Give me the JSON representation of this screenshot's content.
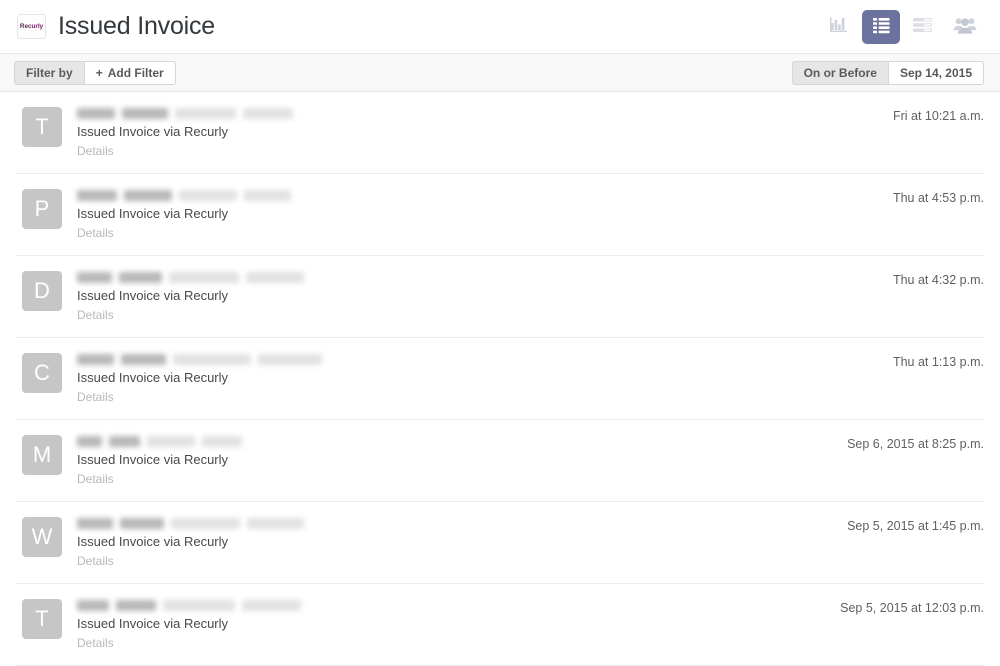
{
  "header": {
    "brand": "Recurly",
    "brand_icon": "recurly-logo-icon",
    "title": "Issued Invoice",
    "actions": [
      {
        "name": "chart-view-icon",
        "label": "Chart view",
        "active": false
      },
      {
        "name": "list-view-icon",
        "label": "List view",
        "active": true
      },
      {
        "name": "detail-view-icon",
        "label": "Detail view",
        "active": false
      },
      {
        "name": "people-icon",
        "label": "People",
        "active": false
      }
    ],
    "accent_active": "#6b729e",
    "icon_inactive": "#ced2da"
  },
  "filter_bar": {
    "filter_label": "Filter by",
    "add_filter_label": "Add Filter",
    "add_filter_plus": "+",
    "date_operator_label": "On or Before",
    "date_value": "Sep 14, 2015"
  },
  "list": {
    "subject_text": "Issued Invoice via Recurly",
    "details_label": "Details",
    "items": [
      {
        "avatar_letter": "T",
        "name_width": 84,
        "detail_width": 110,
        "time": "Fri at 10:21 a.m."
      },
      {
        "avatar_letter": "P",
        "name_width": 88,
        "detail_width": 105,
        "time": "Thu at 4:53 p.m."
      },
      {
        "avatar_letter": "D",
        "name_width": 78,
        "detail_width": 128,
        "time": "Thu at 4:32 p.m."
      },
      {
        "avatar_letter": "C",
        "name_width": 82,
        "detail_width": 142,
        "time": "Thu at 1:13 p.m."
      },
      {
        "avatar_letter": "M",
        "name_width": 56,
        "detail_width": 88,
        "time": "Sep 6, 2015 at 8:25 p.m."
      },
      {
        "avatar_letter": "W",
        "name_width": 80,
        "detail_width": 126,
        "time": "Sep 5, 2015 at 1:45 p.m."
      },
      {
        "avatar_letter": "T",
        "name_width": 72,
        "detail_width": 130,
        "time": "Sep 5, 2015 at 12:03 p.m."
      }
    ]
  }
}
